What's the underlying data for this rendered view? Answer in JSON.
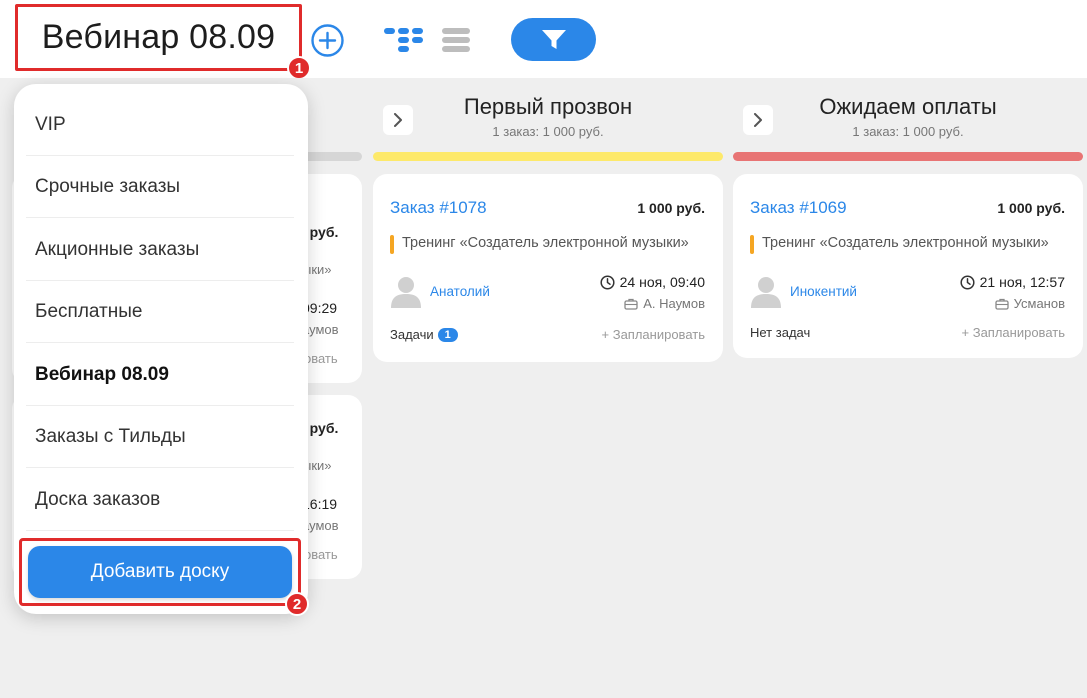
{
  "header": {
    "board_title": "Вебинар 08.09",
    "badge_1": "1",
    "badge_2": "2"
  },
  "colors": {
    "accent": "#2b87e8",
    "highlight_border": "#e02b2b",
    "column_yellow": "#fde96a",
    "column_red": "#e87474",
    "product_mark": "#f5a623",
    "board_bg": "#efefef"
  },
  "icons": {
    "add": "plus-circle-icon",
    "kanban": "kanban-view-icon",
    "list": "list-view-icon",
    "filter": "filter-icon",
    "chevron": "chevron-right-icon",
    "clock": "clock-icon",
    "manager": "briefcase-icon",
    "avatar": "user-avatar-icon"
  },
  "dropdown": {
    "items": [
      {
        "label": "VIP"
      },
      {
        "label": "Срочные заказы"
      },
      {
        "label": "Акционные заказы"
      },
      {
        "label": "Бесплатные"
      },
      {
        "label": "Вебинар 08.09"
      },
      {
        "label": "Заказы с Тильды"
      },
      {
        "label": "Доска заказов"
      }
    ],
    "active_item": "Вебинар 08.09",
    "add_button": "Добавить доску"
  },
  "background_column": {
    "cards": [
      {
        "price_fragment": "0 руб.",
        "product_fragment": "ыки»",
        "time_fragment": "09:29",
        "manager_fragment": "аумов",
        "plan_fragment": "овать"
      },
      {
        "price_fragment": "0 руб.",
        "product_fragment": "ыки»",
        "time_fragment": "16:19",
        "manager_fragment": "аумов",
        "plan_fragment": "овать"
      }
    ]
  },
  "columns": [
    {
      "title": "Первый прозвон",
      "summary": "1 заказ: 1 000 руб.",
      "card": {
        "order": "Заказ #1078",
        "price": "1 000 руб.",
        "product": "Тренинг «Создатель электронной музыки»",
        "client": "Анатолий",
        "date": "24 ноя, 09:40",
        "manager": "А. Наумов",
        "tasks_label": "Задачи",
        "tasks_count": "1",
        "plan": "+ Запланировать"
      }
    },
    {
      "title": "Ожидаем оплаты",
      "summary": "1 заказ: 1 000 руб.",
      "card": {
        "order": "Заказ #1069",
        "price": "1 000 руб.",
        "product": "Тренинг «Создатель электронной музыки»",
        "client": "Инокентий",
        "date": "21 ноя, 12:57",
        "manager": "Усманов",
        "tasks_label": "Нет задач",
        "plan": "+ Запланировать"
      }
    }
  ]
}
